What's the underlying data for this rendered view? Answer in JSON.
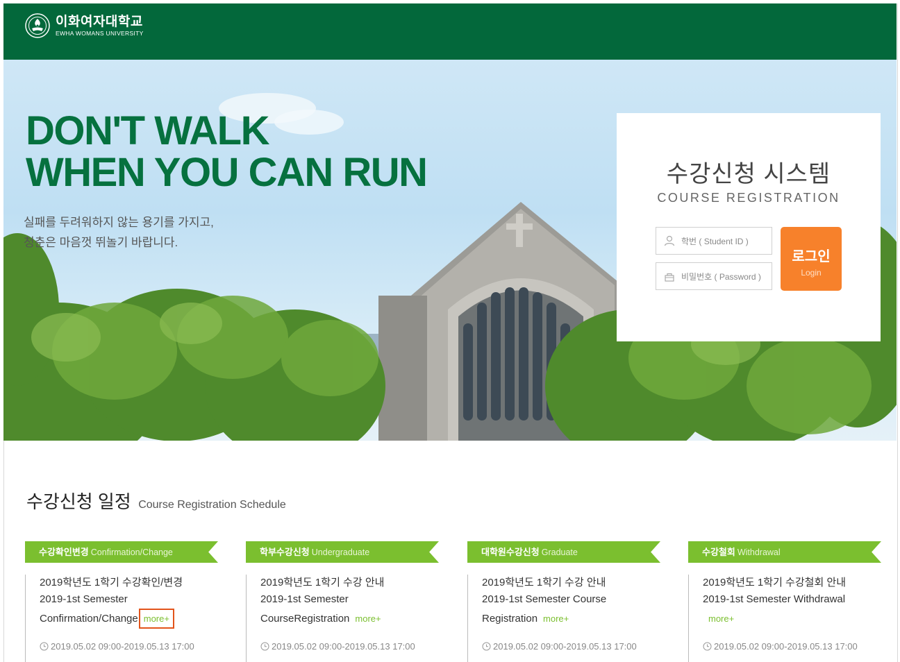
{
  "header": {
    "logo_ko": "이화여자대학교",
    "logo_en": "EWHA WOMANS UNIVERSITY"
  },
  "hero": {
    "slogan_line1": "DON'T WALK",
    "slogan_line2": "WHEN YOU CAN RUN",
    "sub_line1": "실패를 두려워하지 않는 용기를 가지고,",
    "sub_line2": "청춘은 마음껏 뛰놀기 바랍니다."
  },
  "login": {
    "title": "수강신청 시스템",
    "subtitle": "COURSE  REGISTRATION",
    "id_placeholder": "학번 ( Student ID )",
    "pw_placeholder": "비밀번호 ( Password )",
    "button_ko": "로그인",
    "button_en": "Login"
  },
  "schedule": {
    "title_ko": "수강신청 일정",
    "title_en": "Course Registration Schedule",
    "more_label": "more+",
    "cards": [
      {
        "head_ko": "수강확인변경",
        "head_en": "Confirmation/Change",
        "line1": "2019학년도 1학기 수강확인/변경",
        "line2": "2019-1st Semester",
        "line3": "Confirmation/Change",
        "date": "2019.05.02 09:00-2019.05.13 17:00"
      },
      {
        "head_ko": "학부수강신청",
        "head_en": "Undergraduate",
        "line1": "2019학년도 1학기 수강 안내",
        "line2": "2019-1st Semester",
        "line3": "CourseRegistration",
        "date": "2019.05.02 09:00-2019.05.13 17:00"
      },
      {
        "head_ko": "대학원수강신청",
        "head_en": "Graduate",
        "line1": "2019학년도 1학기 수강 안내",
        "line2": "2019-1st Semester Course",
        "line3": "Registration",
        "date": "2019.05.02 09:00-2019.05.13 17:00"
      },
      {
        "head_ko": "수강철회",
        "head_en": "Withdrawal",
        "line1": "2019학년도 1학기 수강철회 안내",
        "line2": "2019-1st Semester Withdrawal",
        "line3": "",
        "date": "2019.05.02 09:00-2019.05.13 17:00"
      }
    ]
  },
  "colors": {
    "header_green": "#03683b",
    "slogan_green": "#06713f",
    "accent_lime": "#7bbf2f",
    "login_orange": "#f7812b",
    "highlight": "#e2541a"
  }
}
